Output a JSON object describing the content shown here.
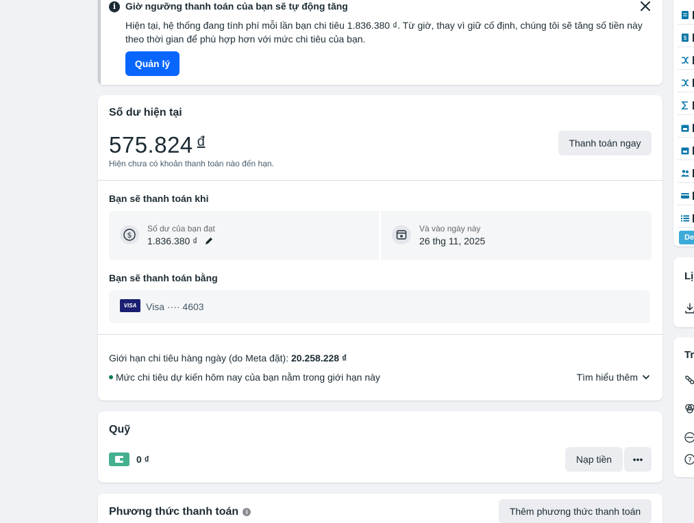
{
  "notice": {
    "title": "Giờ ngưỡng thanh toán của bạn sẽ tự động tăng",
    "body": "Hiện tại, hệ thống đang tính phí mỗi lần bạn chi tiêu 1.836.380 ₫. Từ giờ, thay vì giữ cố định, chúng tôi sẽ tăng số tiền này theo thời gian để phù hợp hơn với mức chi tiêu của bạn.",
    "manage_label": "Quản lý"
  },
  "balance": {
    "title": "Số dư hiện tại",
    "amount": "575.824",
    "currency": "đ",
    "note": "Hiện chưa có khoản thanh toán nào đến hạn.",
    "pay_now_label": "Thanh toán ngay",
    "when_label": "Bạn sẽ thanh toán khi",
    "threshold_label": "Số dư của bạn đạt",
    "threshold_value": "1.836.380 ₫",
    "date_label": "Và vào ngày này",
    "date_value": "26 thg 11, 2025",
    "method_label": "Bạn sẽ thanh toán bằng",
    "card_brand": "VISA",
    "card_text": "Visa ···· 4603",
    "limit_prefix": "Giới hạn chi tiêu hàng ngày (do Meta đặt):",
    "limit_value": "20.258.228 ₫",
    "forecast": "Mức chi tiêu dự kiến hôm nay của bạn nằm trong giới hạn này",
    "learn_more": "Tìm hiểu thêm"
  },
  "fund": {
    "title": "Quỹ",
    "balance": "0 ₫",
    "topup_label": "Nạp tiền",
    "more_label": "•••"
  },
  "methods": {
    "title": "Phương thức thanh toán",
    "help": "i",
    "add_label": "Thêm phương thức thanh toán"
  },
  "side": {
    "tag": "De",
    "panel2_title": "Lị",
    "panel3_title": "Tr"
  },
  "colors": {
    "primary": "#0866ff",
    "visa": "#1a1f71",
    "wallet": "#44b090",
    "side_icons": "#0a76a8",
    "side_tag": "#3dabd9"
  }
}
